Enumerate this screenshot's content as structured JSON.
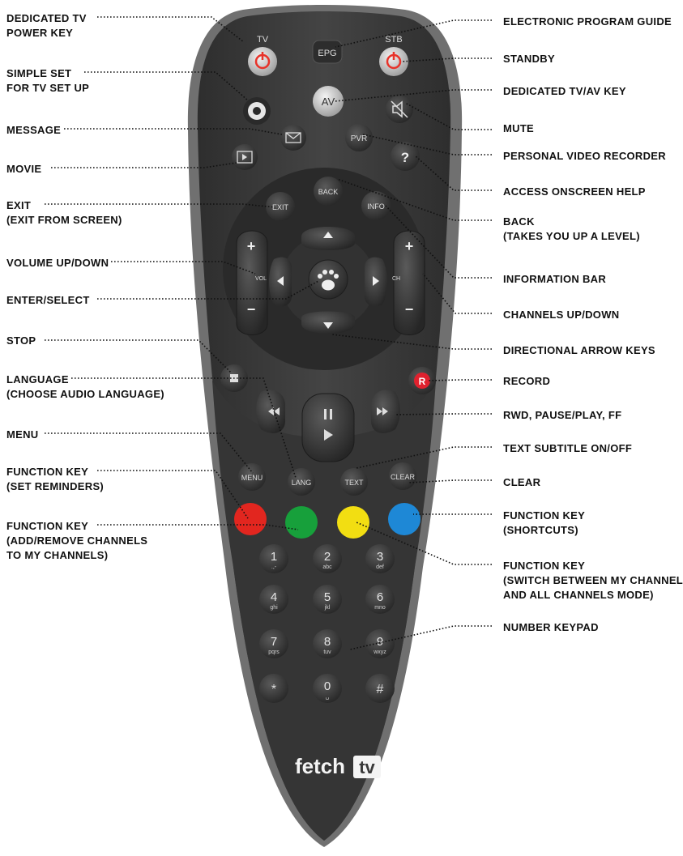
{
  "brand": {
    "logo_text": "fetch",
    "logo_badge": "tv"
  },
  "remote_buttons": {
    "tv": "TV",
    "epg": "EPG",
    "stb": "STB",
    "av": "AV",
    "pvr": "PVR",
    "help": "?",
    "back": "BACK",
    "exit": "EXIT",
    "info": "INFO",
    "vol": "VOL",
    "ch": "CH",
    "record": "R",
    "menu": "MENU",
    "lang": "LANG",
    "text": "TEXT",
    "clear": "CLEAR",
    "plus": "+",
    "minus": "−",
    "star": "*",
    "hash": "#"
  },
  "keypad": [
    {
      "digit": "1",
      "letters": ".,-"
    },
    {
      "digit": "2",
      "letters": "abc"
    },
    {
      "digit": "3",
      "letters": "def"
    },
    {
      "digit": "4",
      "letters": "ghi"
    },
    {
      "digit": "5",
      "letters": "jkl"
    },
    {
      "digit": "6",
      "letters": "mno"
    },
    {
      "digit": "7",
      "letters": "pqrs"
    },
    {
      "digit": "8",
      "letters": "tuv"
    },
    {
      "digit": "9",
      "letters": "wxyz"
    },
    {
      "digit": "0",
      "letters": "␣"
    }
  ],
  "colors": {
    "remote_body": "#3a3a3a",
    "remote_rim": "#6f6f6f",
    "button": "#2d2d2d",
    "power_red": "#e8332a",
    "record_red": "#e0212e",
    "fn_red": "#e2261f",
    "fn_green": "#17a03b",
    "fn_yellow": "#f2de12",
    "fn_blue": "#1e88d6"
  },
  "callouts_left": [
    {
      "line1": "DEDICATED TV",
      "line2": "POWER KEY"
    },
    {
      "line1": "SIMPLE SET",
      "line2": "FOR TV SET UP"
    },
    {
      "line1": "MESSAGE",
      "line2": ""
    },
    {
      "line1": "MOVIE",
      "line2": ""
    },
    {
      "line1": "EXIT",
      "line2": "(EXIT FROM SCREEN)"
    },
    {
      "line1": "VOLUME UP/DOWN",
      "line2": ""
    },
    {
      "line1": "ENTER/SELECT",
      "line2": ""
    },
    {
      "line1": "STOP",
      "line2": ""
    },
    {
      "line1": "LANGUAGE",
      "line2": "(CHOOSE AUDIO LANGUAGE)"
    },
    {
      "line1": "MENU",
      "line2": ""
    },
    {
      "line1": "FUNCTION KEY",
      "line2": "(SET REMINDERS)"
    },
    {
      "line1": "FUNCTION KEY",
      "line2": "(ADD/REMOVE CHANNELS",
      "line3": "TO MY CHANNELS)"
    }
  ],
  "callouts_right": [
    {
      "line1": "ELECTRONIC PROGRAM GUIDE",
      "line2": ""
    },
    {
      "line1": "STANDBY",
      "line2": ""
    },
    {
      "line1": "DEDICATED TV/AV KEY",
      "line2": ""
    },
    {
      "line1": "MUTE",
      "line2": ""
    },
    {
      "line1": "PERSONAL VIDEO RECORDER",
      "line2": ""
    },
    {
      "line1": "ACCESS ONSCREEN HELP",
      "line2": ""
    },
    {
      "line1": "BACK",
      "line2": "(TAKES YOU UP A LEVEL)"
    },
    {
      "line1": "INFORMATION BAR",
      "line2": ""
    },
    {
      "line1": "CHANNELS UP/DOWN",
      "line2": ""
    },
    {
      "line1": "DIRECTIONAL ARROW KEYS",
      "line2": ""
    },
    {
      "line1": "RECORD",
      "line2": ""
    },
    {
      "line1": "RWD, PAUSE/PLAY, FF",
      "line2": ""
    },
    {
      "line1": "TEXT SUBTITLE ON/OFF",
      "line2": ""
    },
    {
      "line1": "CLEAR",
      "line2": ""
    },
    {
      "line1": "FUNCTION KEY",
      "line2": "(SHORTCUTS)"
    },
    {
      "line1": "FUNCTION KEY",
      "line2": "(SWITCH BETWEEN MY CHANNEL",
      "line3": "AND ALL CHANNELS MODE)"
    },
    {
      "line1": "NUMBER KEYPAD",
      "line2": ""
    }
  ]
}
